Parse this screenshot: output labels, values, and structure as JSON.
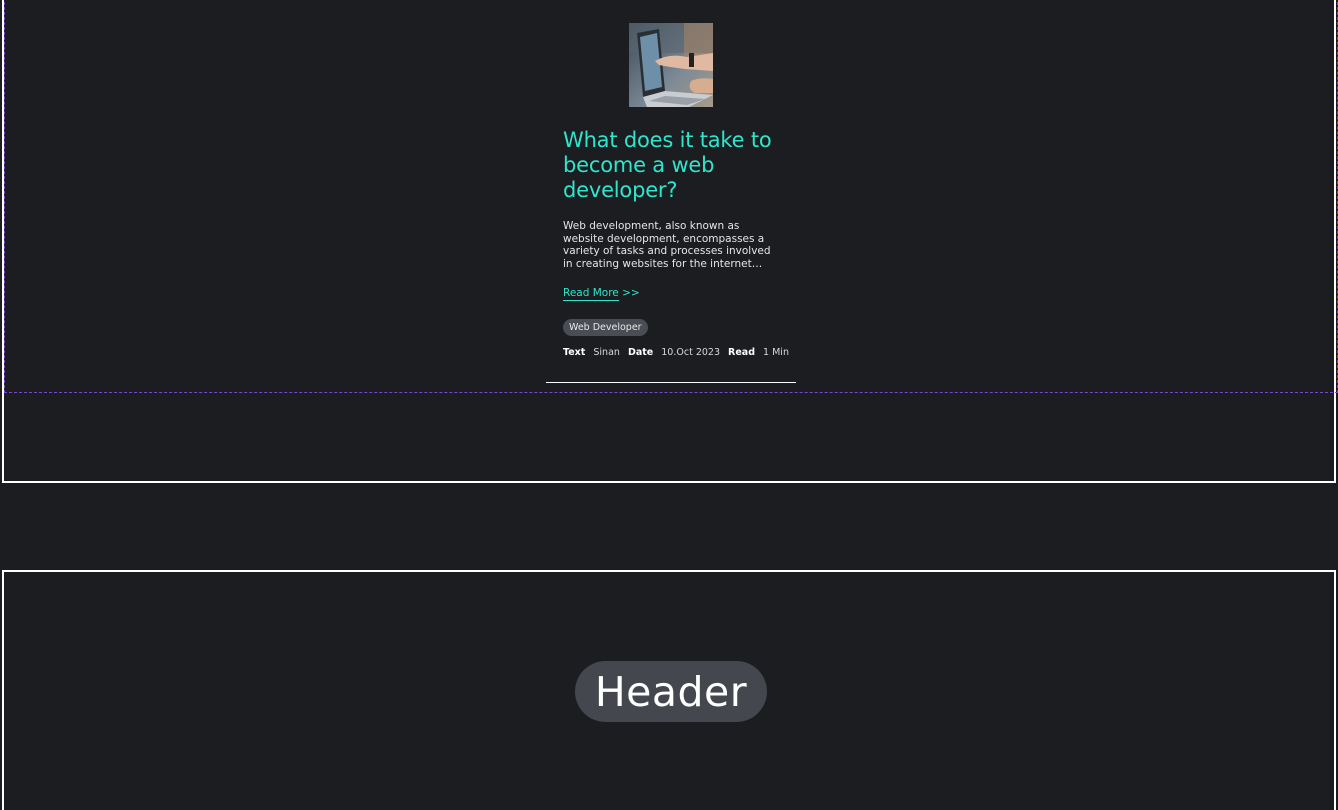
{
  "article": {
    "title": "What does it take to become a web developer?",
    "excerpt": "Web development, also known as website development, encompasses a variety of tasks and processes involved in creating websites for the internet…",
    "read_more": "Read More",
    "read_more_arrow": ">>",
    "tag": "Web Developer",
    "meta": {
      "text_label": "Text",
      "author": "Sinan",
      "date_label": "Date",
      "date": "10.Oct 2023",
      "read_label": "Read",
      "read_time": "1 Min"
    },
    "thumbnail_icon": "laptop-photo"
  },
  "header_section": {
    "label": "Header"
  },
  "colors": {
    "background": "#1b1d21",
    "accent": "#2ee6cc",
    "dashed_border": "#7d45d4",
    "pill": "#45474f"
  }
}
